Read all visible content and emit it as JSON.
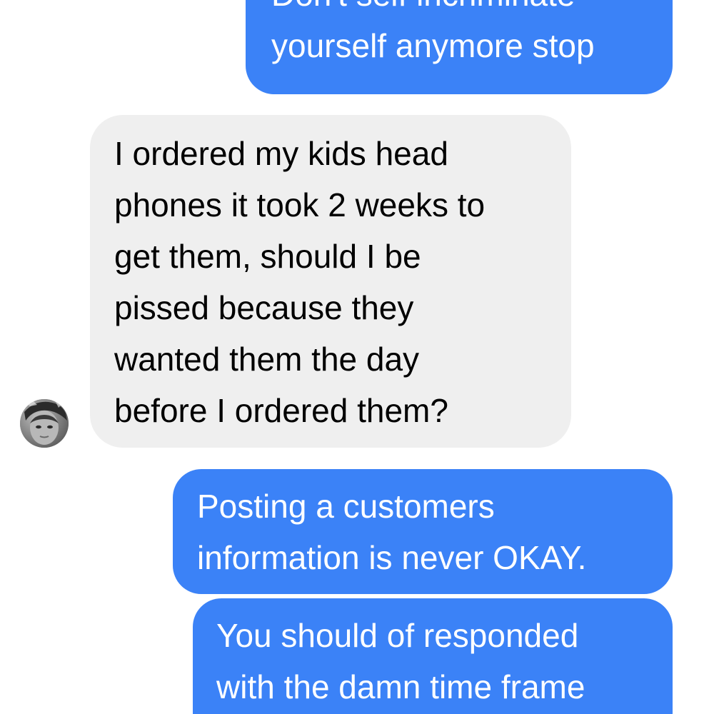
{
  "conversation": {
    "messages": [
      {
        "sender": "me",
        "lines": [
          "Don't self incriminate",
          "yourself anymore stop"
        ]
      },
      {
        "sender": "them",
        "lines": [
          "I ordered my kids head",
          "phones it took 2 weeks to",
          "get them, should I be",
          "pissed because they",
          "wanted them the day",
          "before I ordered them?"
        ]
      },
      {
        "sender": "me",
        "lines": [
          "Posting a customers",
          "information is never OKAY."
        ]
      },
      {
        "sender": "me",
        "lines": [
          "You should of responded",
          "with the damn time frame"
        ]
      }
    ],
    "colors": {
      "outgoing_bubble": "#3b82f7",
      "incoming_bubble": "#efefef",
      "outgoing_text": "#ffffff",
      "incoming_text": "#000000"
    },
    "avatar_icon": "user-avatar-photo"
  }
}
